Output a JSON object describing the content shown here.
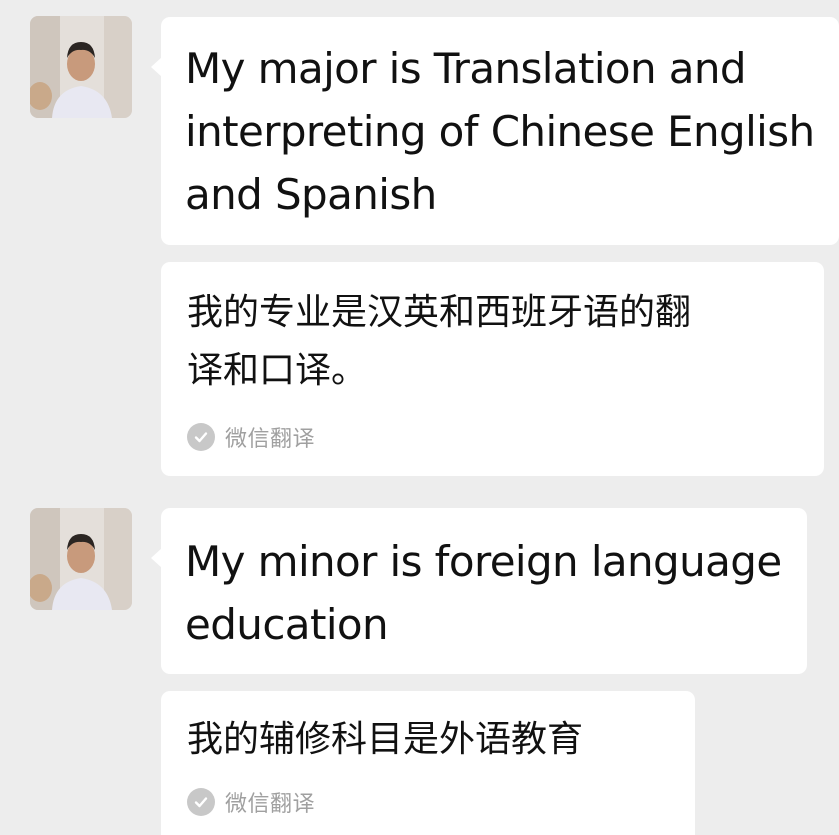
{
  "messages": [
    {
      "sender_avatar": "user-avatar-photo",
      "text": "My major is Translation and\ninterpreting of Chinese English\nand Spanish",
      "translation": {
        "text": "我的专业是汉英和西班牙语的翻\n译和口译。",
        "source_icon": "check-circle-icon",
        "source_label": "微信翻译"
      }
    },
    {
      "sender_avatar": "user-avatar-photo",
      "text": "My minor is foreign language\neducation",
      "translation": {
        "text": "我的辅修科目是外语教育",
        "source_icon": "check-circle-icon",
        "source_label": "微信翻译"
      }
    }
  ],
  "colors": {
    "background": "#ededed",
    "bubble": "#ffffff",
    "text": "#111111",
    "source_label": "#a0a0a0",
    "check_icon_bg": "#c8c8c8"
  }
}
